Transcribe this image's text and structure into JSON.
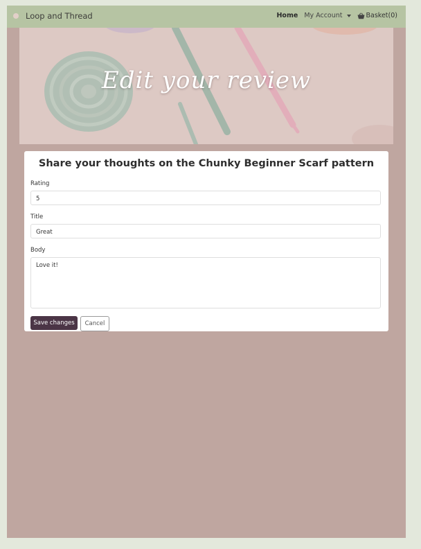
{
  "navbar": {
    "brand": "Loop and Thread",
    "home_label": "Home",
    "account_label": "My Account",
    "basket_label": "Basket(0)"
  },
  "hero": {
    "title": "Edit your review"
  },
  "form": {
    "heading": "Share your thoughts on the Chunky Beginner Scarf pattern",
    "rating_label": "Rating",
    "rating_value": "5",
    "title_label": "Title",
    "title_value": "Great",
    "body_label": "Body",
    "body_value": "Love it!",
    "save_label": "Save changes",
    "cancel_label": "Cancel"
  },
  "colors": {
    "navbar": "#b6c4a3",
    "page_background": "#bfa6a0",
    "primary_button": "#4b3546"
  },
  "icons": [
    "brand-logo-icon",
    "caret-down-icon",
    "basket-icon"
  ]
}
